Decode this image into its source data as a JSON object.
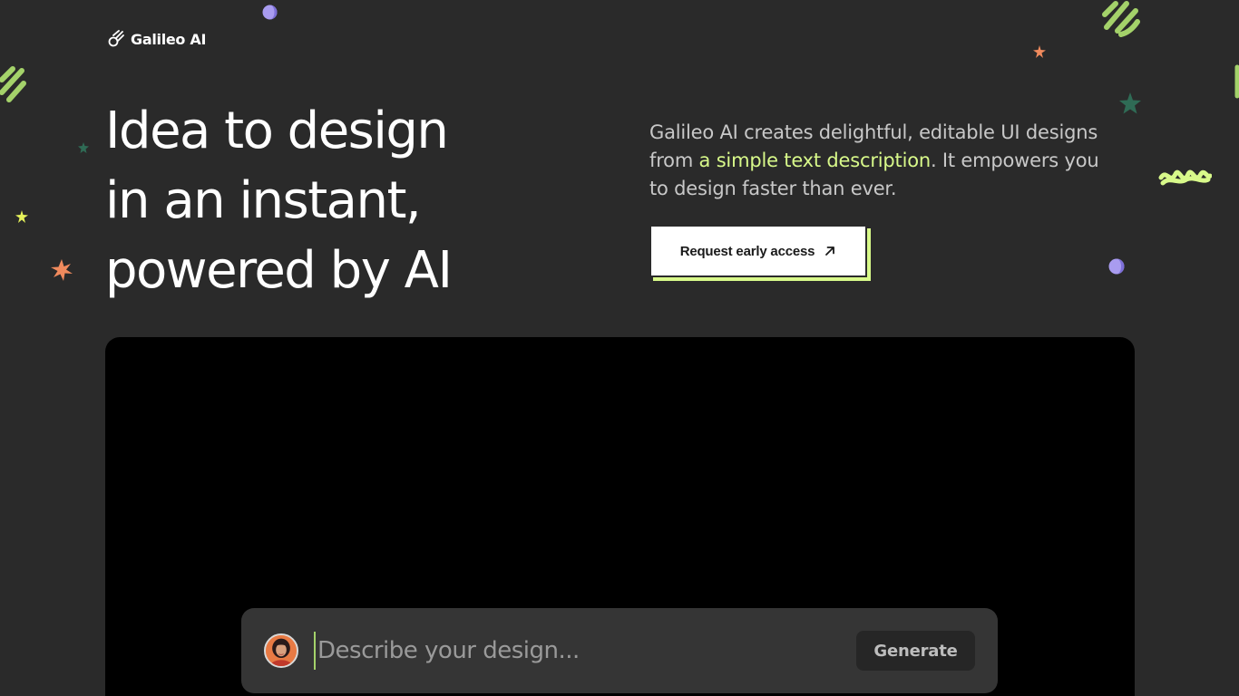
{
  "brand": {
    "name": "Galileo AI",
    "icon": "galileo-logo-icon"
  },
  "hero": {
    "headline_lines": [
      "Idea to design",
      "in an instant,",
      "powered by AI"
    ],
    "description_before": "Galileo AI creates delightful, editable UI designs from ",
    "description_highlight": "a simple text description",
    "description_after": ". It empowers you to design faster than ever.",
    "cta_label": "Request early access",
    "cta_icon": "arrow-up-right-icon"
  },
  "prompt": {
    "placeholder": "Describe your design...",
    "value": "",
    "generate_label": "Generate",
    "avatar_icon": "user-avatar"
  },
  "colors": {
    "background": "#2a2a2a",
    "accent_green": "#d8f98a",
    "accent_purple": "#a99cf0",
    "accent_orange": "#f08a5d",
    "dark_green": "#2f6b55",
    "panel": "#000000",
    "prompt_bar": "#353535"
  }
}
